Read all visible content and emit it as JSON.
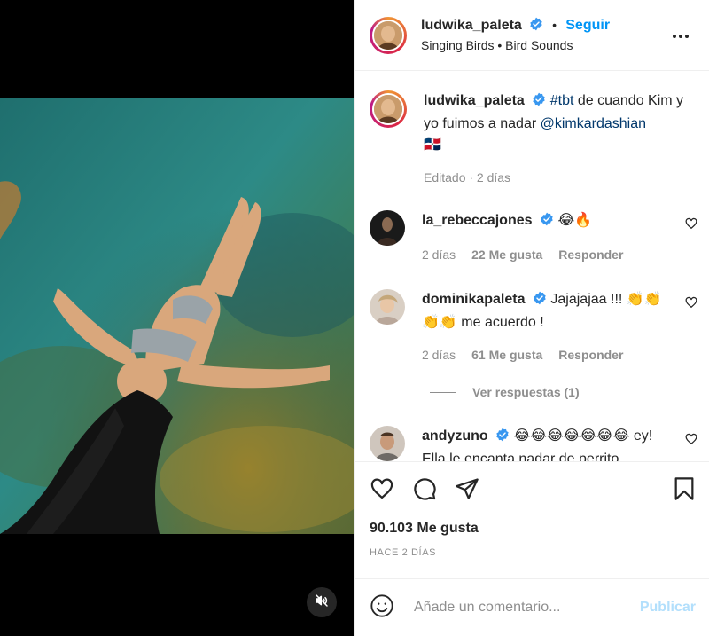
{
  "header": {
    "username": "ludwika_paleta",
    "separator": "•",
    "follow_label": "Seguir",
    "audio": "Singing Birds • Bird Sounds"
  },
  "caption": {
    "username": "ludwika_paleta",
    "hashtag": "#tbt",
    "text": " de cuando Kim y yo fuimos a nadar ",
    "mention": "@kimkardashian",
    "flag": "🇩🇴",
    "edited": "Editado · 2 días"
  },
  "comments": [
    {
      "username": "la_rebeccajones",
      "text": "😂🔥",
      "time": "2 días",
      "likes": "22 Me gusta",
      "reply": "Responder"
    },
    {
      "username": "dominikapaleta",
      "text": "Jajajajaa !!! 👏👏👏👏 me acuerdo !",
      "time": "2 días",
      "likes": "61 Me gusta",
      "reply": "Responder"
    },
    {
      "username": "andyzuno",
      "text": "😂😂😂😂😂😂😂 ey! Ella le encanta nadar de perrito"
    }
  ],
  "replies_label": "Ver respuestas (1)",
  "likes_total": "90.103 Me gusta",
  "time_ago": "HACE 2 DÍAS",
  "add_comment": {
    "placeholder": "Añade un comentario...",
    "publish_label": "Publicar"
  },
  "icons": {
    "verified": "verified-badge-icon",
    "more": "more-options-icon",
    "like": "heart-icon",
    "comment": "comment-icon",
    "share": "paper-plane-icon",
    "save": "bookmark-icon",
    "emoji": "emoji-icon",
    "mute": "muted-speaker-icon"
  },
  "colors": {
    "accent": "#0095f6",
    "verified": "#3897f0",
    "muted_text": "#8e8e8e",
    "publish_disabled": "#b2dffc"
  }
}
